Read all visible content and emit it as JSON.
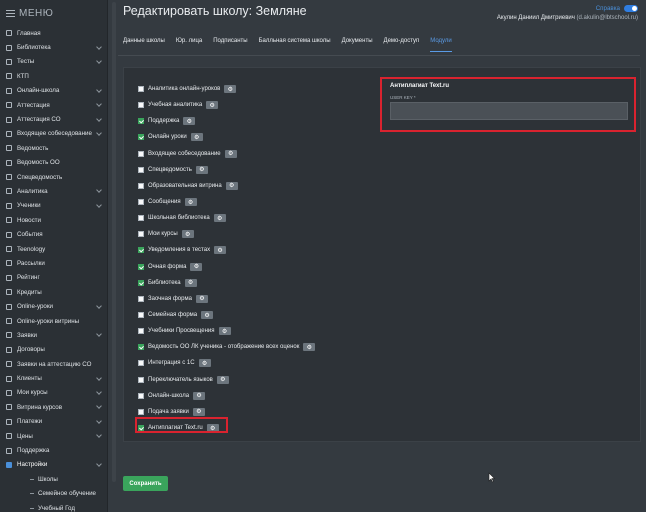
{
  "sidebar": {
    "menu_label": "МЕНЮ",
    "items": [
      {
        "label": "Главная",
        "chevron": false
      },
      {
        "label": "Библиотека",
        "chevron": true
      },
      {
        "label": "Тесты",
        "chevron": true
      },
      {
        "label": "КТП",
        "chevron": false
      },
      {
        "label": "Онлайн-школа",
        "chevron": true
      },
      {
        "label": "Аттестация",
        "chevron": true
      },
      {
        "label": "Аттестация СО",
        "chevron": true
      },
      {
        "label": "Входящее собеседование",
        "chevron": true
      },
      {
        "label": "Ведомость",
        "chevron": false
      },
      {
        "label": "Ведомость ОО",
        "chevron": false
      },
      {
        "label": "Спецведомость",
        "chevron": false
      },
      {
        "label": "Аналитика",
        "chevron": true
      },
      {
        "label": "Ученики",
        "chevron": true
      },
      {
        "label": "Новости",
        "chevron": false
      },
      {
        "label": "События",
        "chevron": false
      },
      {
        "label": "Teenology",
        "chevron": false
      },
      {
        "label": "Рассылки",
        "chevron": false
      },
      {
        "label": "Рейтинг",
        "chevron": false
      },
      {
        "label": "Кредиты",
        "chevron": false
      },
      {
        "label": "Online-уроки",
        "chevron": true
      },
      {
        "label": "Online-уроки витрины",
        "chevron": false
      },
      {
        "label": "Заявки",
        "chevron": true
      },
      {
        "label": "Договоры",
        "chevron": false
      },
      {
        "label": "Заявки на аттестацию СО",
        "chevron": false
      },
      {
        "label": "Клиенты",
        "chevron": true
      },
      {
        "label": "Мои курсы",
        "chevron": true
      },
      {
        "label": "Витрина курсов",
        "chevron": true
      },
      {
        "label": "Платежи",
        "chevron": true
      },
      {
        "label": "Цены",
        "chevron": true
      },
      {
        "label": "Поддержка",
        "chevron": false
      },
      {
        "label": "Настройки",
        "chevron": true
      }
    ],
    "subitems": [
      "Школы",
      "Семейное обучение",
      "Учебный Год"
    ]
  },
  "header": {
    "title": "Редактировать школу: Земляне",
    "help_label": "Справка",
    "user_name": "Акулин Даниил Дмитриевич",
    "user_email": "(d.akulin@lbtschool.ru)"
  },
  "tabs": [
    {
      "label": "Данные школы",
      "active": false
    },
    {
      "label": "Юр. лица",
      "active": false
    },
    {
      "label": "Подписанты",
      "active": false
    },
    {
      "label": "Балльная система школы",
      "active": false
    },
    {
      "label": "Документы",
      "active": false
    },
    {
      "label": "Демо-доступ",
      "active": false
    },
    {
      "label": "Модули",
      "active": true
    }
  ],
  "modules": [
    {
      "label": "Аналитика онлайн-уроков",
      "checked": false
    },
    {
      "label": "Учебная аналитика",
      "checked": false
    },
    {
      "label": "Поддержка",
      "checked": true
    },
    {
      "label": "Онлайн уроки",
      "checked": true
    },
    {
      "label": "Входящее собеседование",
      "checked": false
    },
    {
      "label": "Спецведомость",
      "checked": false
    },
    {
      "label": "Образовательная витрина",
      "checked": false
    },
    {
      "label": "Сообщения",
      "checked": false
    },
    {
      "label": "Школьная библиотека",
      "checked": false
    },
    {
      "label": "Мои курсы",
      "checked": false
    },
    {
      "label": "Уведомления в тестах",
      "checked": true
    },
    {
      "label": "Очная форма",
      "checked": true
    },
    {
      "label": "Библиотека",
      "checked": true
    },
    {
      "label": "Заочная форма",
      "checked": false
    },
    {
      "label": "Семейная форма",
      "checked": false
    },
    {
      "label": "Учебники Просвещения",
      "checked": false
    },
    {
      "label": "Ведомость ОО ЛК ученика - отображение всех оценок",
      "checked": true
    },
    {
      "label": "Интеграция с 1С",
      "checked": false
    },
    {
      "label": "Переключатель языков",
      "checked": false
    },
    {
      "label": "Онлайн-школа",
      "checked": false
    },
    {
      "label": "Подача заявки",
      "checked": false
    },
    {
      "label": "Антиплагиат Text.ru",
      "checked": true
    }
  ],
  "settings_panel": {
    "title": "Антиплагиат Text.ru",
    "field_label": "USER KEY *",
    "field_value": ""
  },
  "save_label": "Сохранить",
  "colors": {
    "accent": "#2f7de1",
    "success": "#3aa45c",
    "highlight": "#d9232f"
  }
}
